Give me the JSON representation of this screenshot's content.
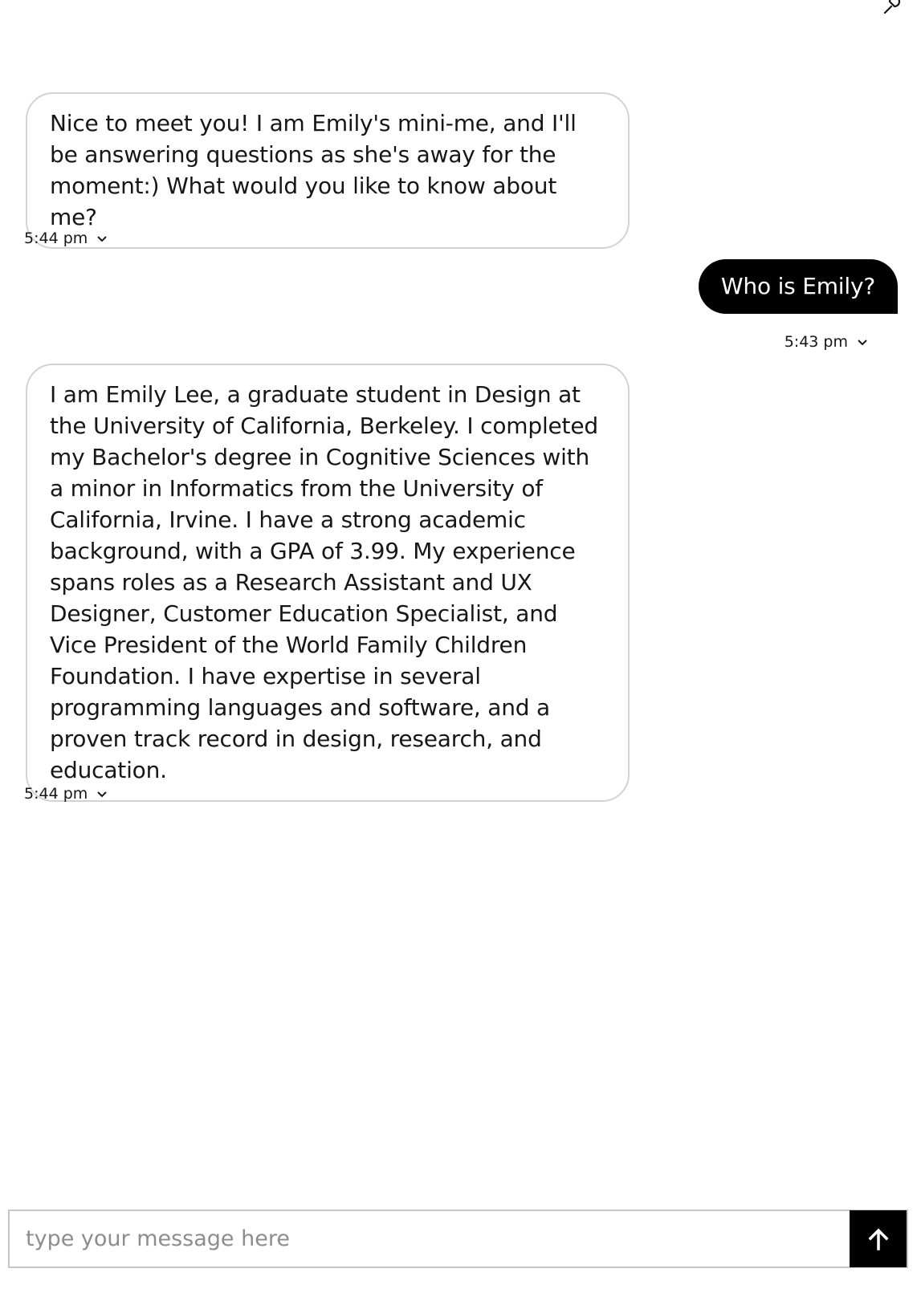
{
  "header": {
    "corner_icon": "pin-icon"
  },
  "messages": [
    {
      "sender": "bot",
      "text": "Nice to meet you! I am Emily's mini-me, and I'll be answering questions as she's away for the moment:) What would you like to know about me?",
      "time": "5:44 pm"
    },
    {
      "sender": "user",
      "text": "Who is Emily?",
      "time": "5:43 pm"
    },
    {
      "sender": "bot",
      "text": "I am Emily Lee, a graduate student in Design at the University of California, Berkeley. I completed my Bachelor's degree in Cognitive Sciences with a minor in Informatics from the University of California, Irvine. I have a strong academic background, with a GPA of 3.99. My experience spans roles as a Research Assistant and UX Designer, Customer Education Specialist, and Vice President of the World Family Children Foundation. I have expertise in several programming languages and software, and a proven track record in design, research, and education.",
      "time": "5:44 pm"
    }
  ],
  "composer": {
    "placeholder": "type your message here",
    "value": "",
    "send_icon": "arrow-up-icon"
  },
  "colors": {
    "user_bubble": "#000000",
    "bot_bubble_border": "#d3d3d3",
    "send_button": "#000000"
  }
}
